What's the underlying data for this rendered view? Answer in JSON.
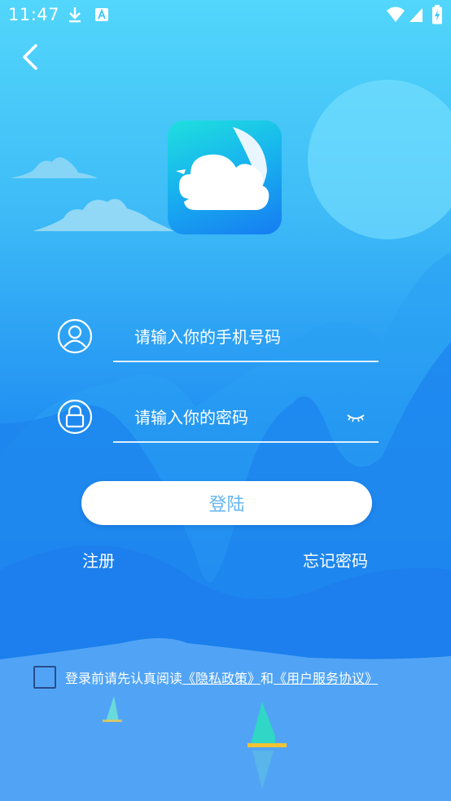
{
  "status_bar": {
    "time": "11:47"
  },
  "login_form": {
    "phone_placeholder": "请输入你的手机号码",
    "password_placeholder": "请输入你的密码",
    "login_label": "登陆"
  },
  "links": {
    "register": "注册",
    "forgot_password": "忘记密码"
  },
  "agreement": {
    "prefix": "登录前请先认真阅读",
    "privacy_link": "《隐私政策》",
    "connector": "和",
    "terms_link": "《用户服务协议》",
    "checked": false
  },
  "icons": {
    "back": "chevron-left-icon",
    "user": "user-icon",
    "lock": "lock-icon",
    "eye": "eye-closed-icon",
    "app": "cloud-moon-icon"
  },
  "colors": {
    "background_top": "#52d6fb",
    "background_mid": "#1f8df2",
    "button_text": "#64b5f0",
    "checkbox_border": "#2a4b8c"
  }
}
